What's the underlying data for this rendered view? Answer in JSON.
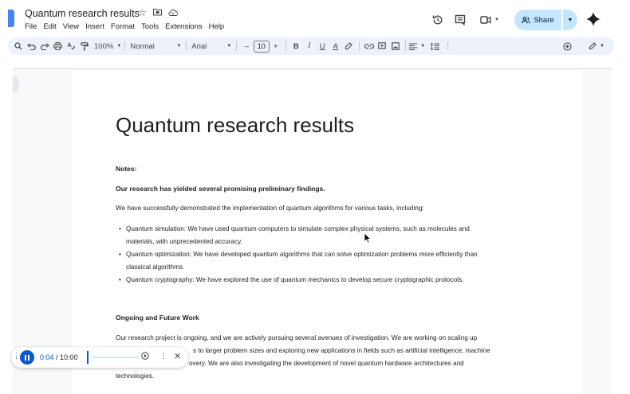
{
  "document": {
    "title": "Quantum research results",
    "title_icons": [
      "star-icon",
      "move-to-folder-icon",
      "cloud-status-icon"
    ]
  },
  "menu": [
    "File",
    "Edit",
    "View",
    "Insert",
    "Format",
    "Tools",
    "Extensions",
    "Help"
  ],
  "header_actions": {
    "share_label": "Share",
    "icons": [
      "history-icon",
      "comments-icon",
      "meet-icon",
      "gemini-icon"
    ]
  },
  "toolbar": {
    "zoom": "100%",
    "style": "Normal",
    "font": "Arial",
    "font_size": "10",
    "decrease_label": "–",
    "increase_label": "+",
    "bold_label": "B",
    "italic_label": "I",
    "underline_label": "U",
    "textcolor_label": "A"
  },
  "content": {
    "heading": "Quantum research results",
    "notes_label": "Notes:",
    "intro_bold": "Our research has yielded several promising preliminary findings.",
    "intro": "We have successfully demonstrated the implementation of quantum algorithms for various tasks, including:",
    "bullets": [
      {
        "line1": "Quantum simulation: We have used quantum computers to simulate complex physical systems, such as molecules and",
        "line2": "materials, with unprecedented accuracy."
      },
      {
        "line1": "Quantum optimization: We have developed quantum algorithms that can solve optimization problems more efficiently than",
        "line2": "classical algorithms."
      },
      {
        "line1": "Quantum cryptography: We have explored the use of quantum mechanics to develop secure cryptographic protocols.",
        "line2": ""
      }
    ],
    "section2_heading": "Ongoing and Future Work",
    "section2_lines": [
      "Our research project is ongoing, and we are actively pursuing several avenues of investigation. We are working on scaling up",
      "s to larger problem sizes and exploring new applications in fields such as artificial intelligence, machine",
      "overy. We are also investigating the development of novel quantum hardware architectures and",
      "technologies."
    ]
  },
  "player": {
    "current_time": "0:04",
    "separator": " / ",
    "total_time": "10:00",
    "progress_fraction": 0.0067
  },
  "colors": {
    "accent": "#0b57d0",
    "share_bg": "#c2e7ff",
    "toolbar_bg": "#edf2fa",
    "canvas_bg": "#f8f9fa"
  }
}
